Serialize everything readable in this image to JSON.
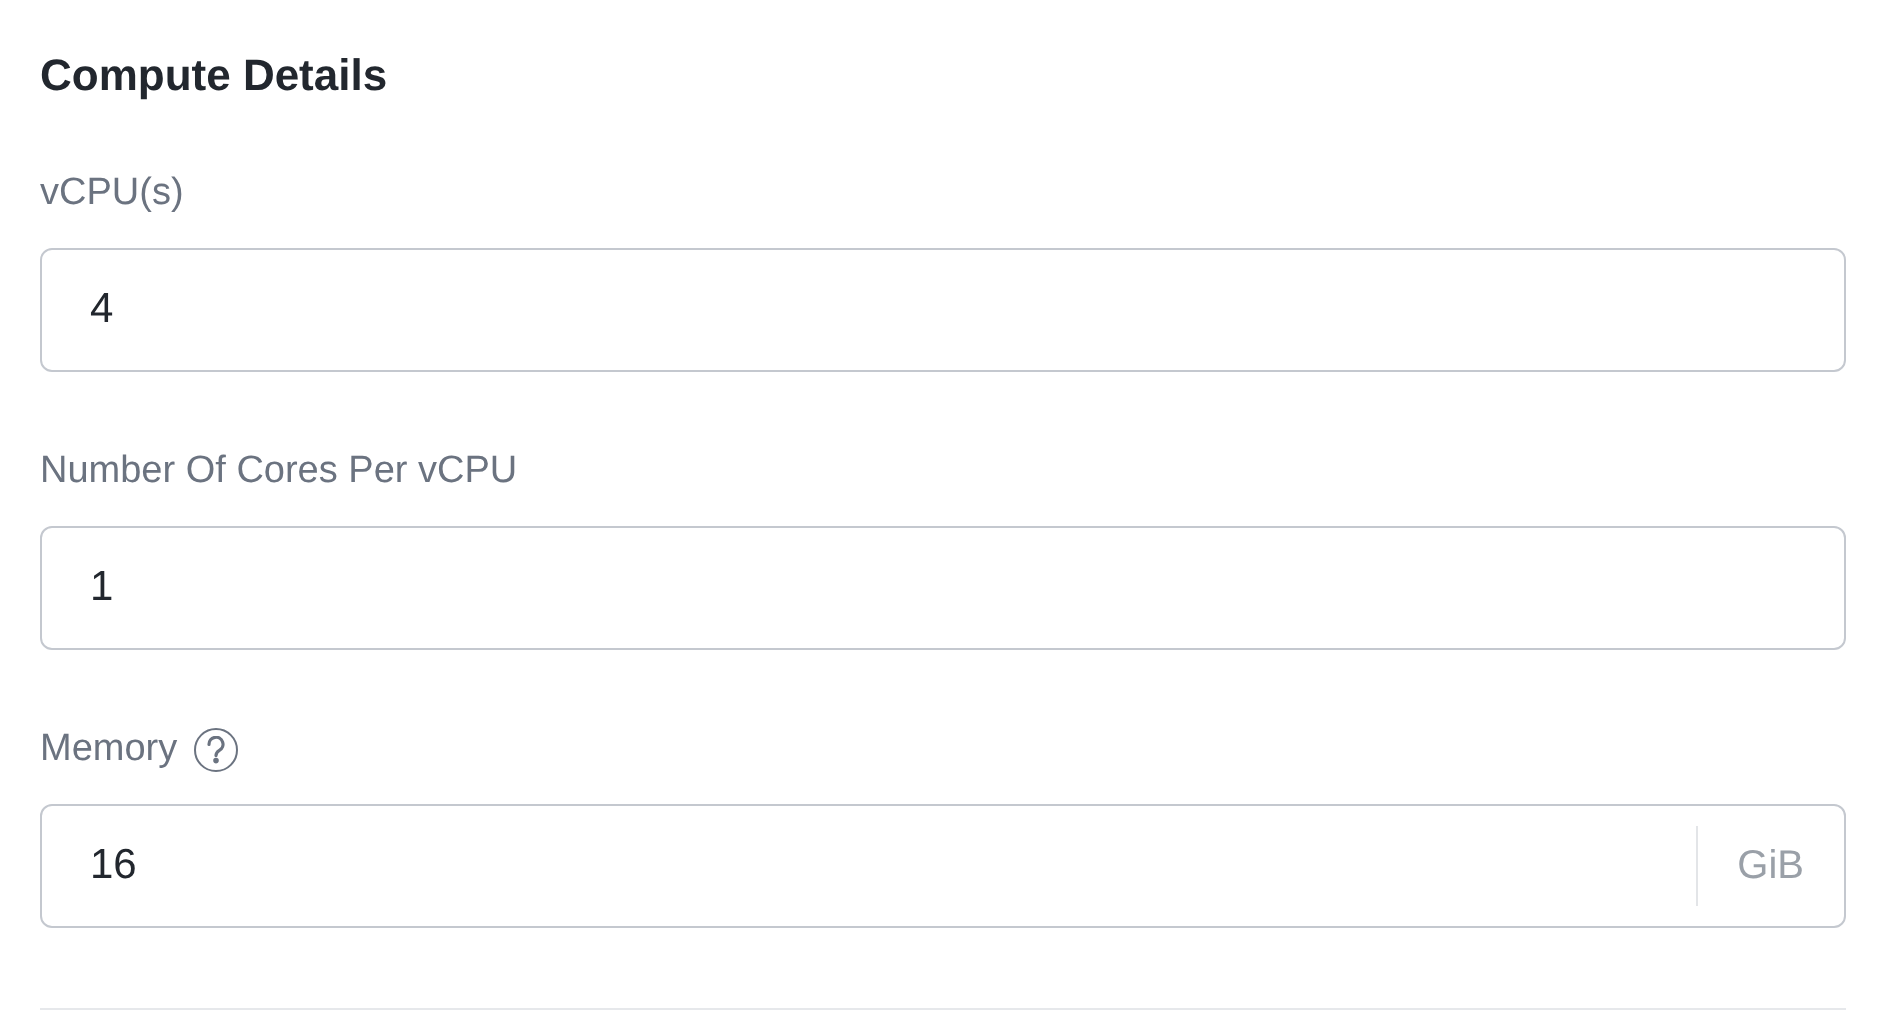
{
  "section": {
    "title": "Compute Details"
  },
  "fields": [
    {
      "label": "vCPU(s)",
      "value": "4",
      "help": false
    },
    {
      "label": "Number Of Cores Per vCPU",
      "value": "1",
      "help": false
    },
    {
      "label": "Memory",
      "value": "16",
      "help": true,
      "unit": "GiB"
    }
  ]
}
